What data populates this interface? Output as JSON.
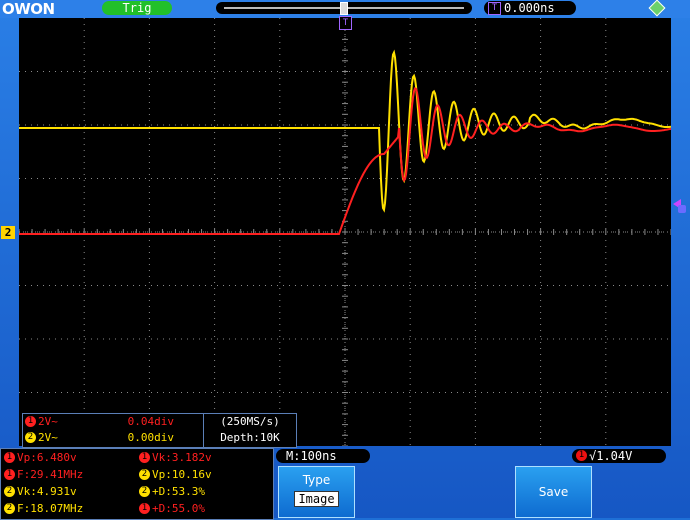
{
  "header": {
    "logo": "OWON",
    "trig_status": "Trig",
    "trigger_time": "0.000ns",
    "trigger_time_tag": "T",
    "trig_pos_tag": "T"
  },
  "channel_markers": {
    "ch2": "2"
  },
  "channel_info": [
    {
      "num": "1",
      "scale": "2V~",
      "offset": "0.04div",
      "color": "#ff2020"
    },
    {
      "num": "2",
      "scale": "2V~",
      "offset": "0.00div",
      "color": "#ffe000"
    }
  ],
  "acquisition": {
    "rate": "(250MS/s)",
    "depth": "Depth:10K"
  },
  "measurements": [
    {
      "ch": "1",
      "text": "Vp:6.480v",
      "color": "#ff2020"
    },
    {
      "ch": "1",
      "text": "Vk:3.182v",
      "color": "#ff2020"
    },
    {
      "ch": "1",
      "text": "F:29.41MHz",
      "color": "#ff2020"
    },
    {
      "ch": "2",
      "text": "Vp:10.16v",
      "color": "#ffe000"
    },
    {
      "ch": "2",
      "text": "Vk:4.931v",
      "color": "#ffe000"
    },
    {
      "ch": "2",
      "text": "+D:53.3%",
      "color": "#ffe000"
    },
    {
      "ch": "2",
      "text": "F:18.07MHz",
      "color": "#ffe000"
    },
    {
      "ch": "1",
      "text": "+D:55.0%",
      "color": "#ff2020"
    }
  ],
  "timebase": "M:100ns",
  "trigger": {
    "num": "1",
    "level": "√1.04V"
  },
  "softkeys": {
    "type_label": "Type",
    "type_value": "Image",
    "save_label": "Save"
  },
  "colors": {
    "ch1": "#ff2020",
    "ch2": "#ffe000",
    "grid": "#8a8a8a"
  }
}
